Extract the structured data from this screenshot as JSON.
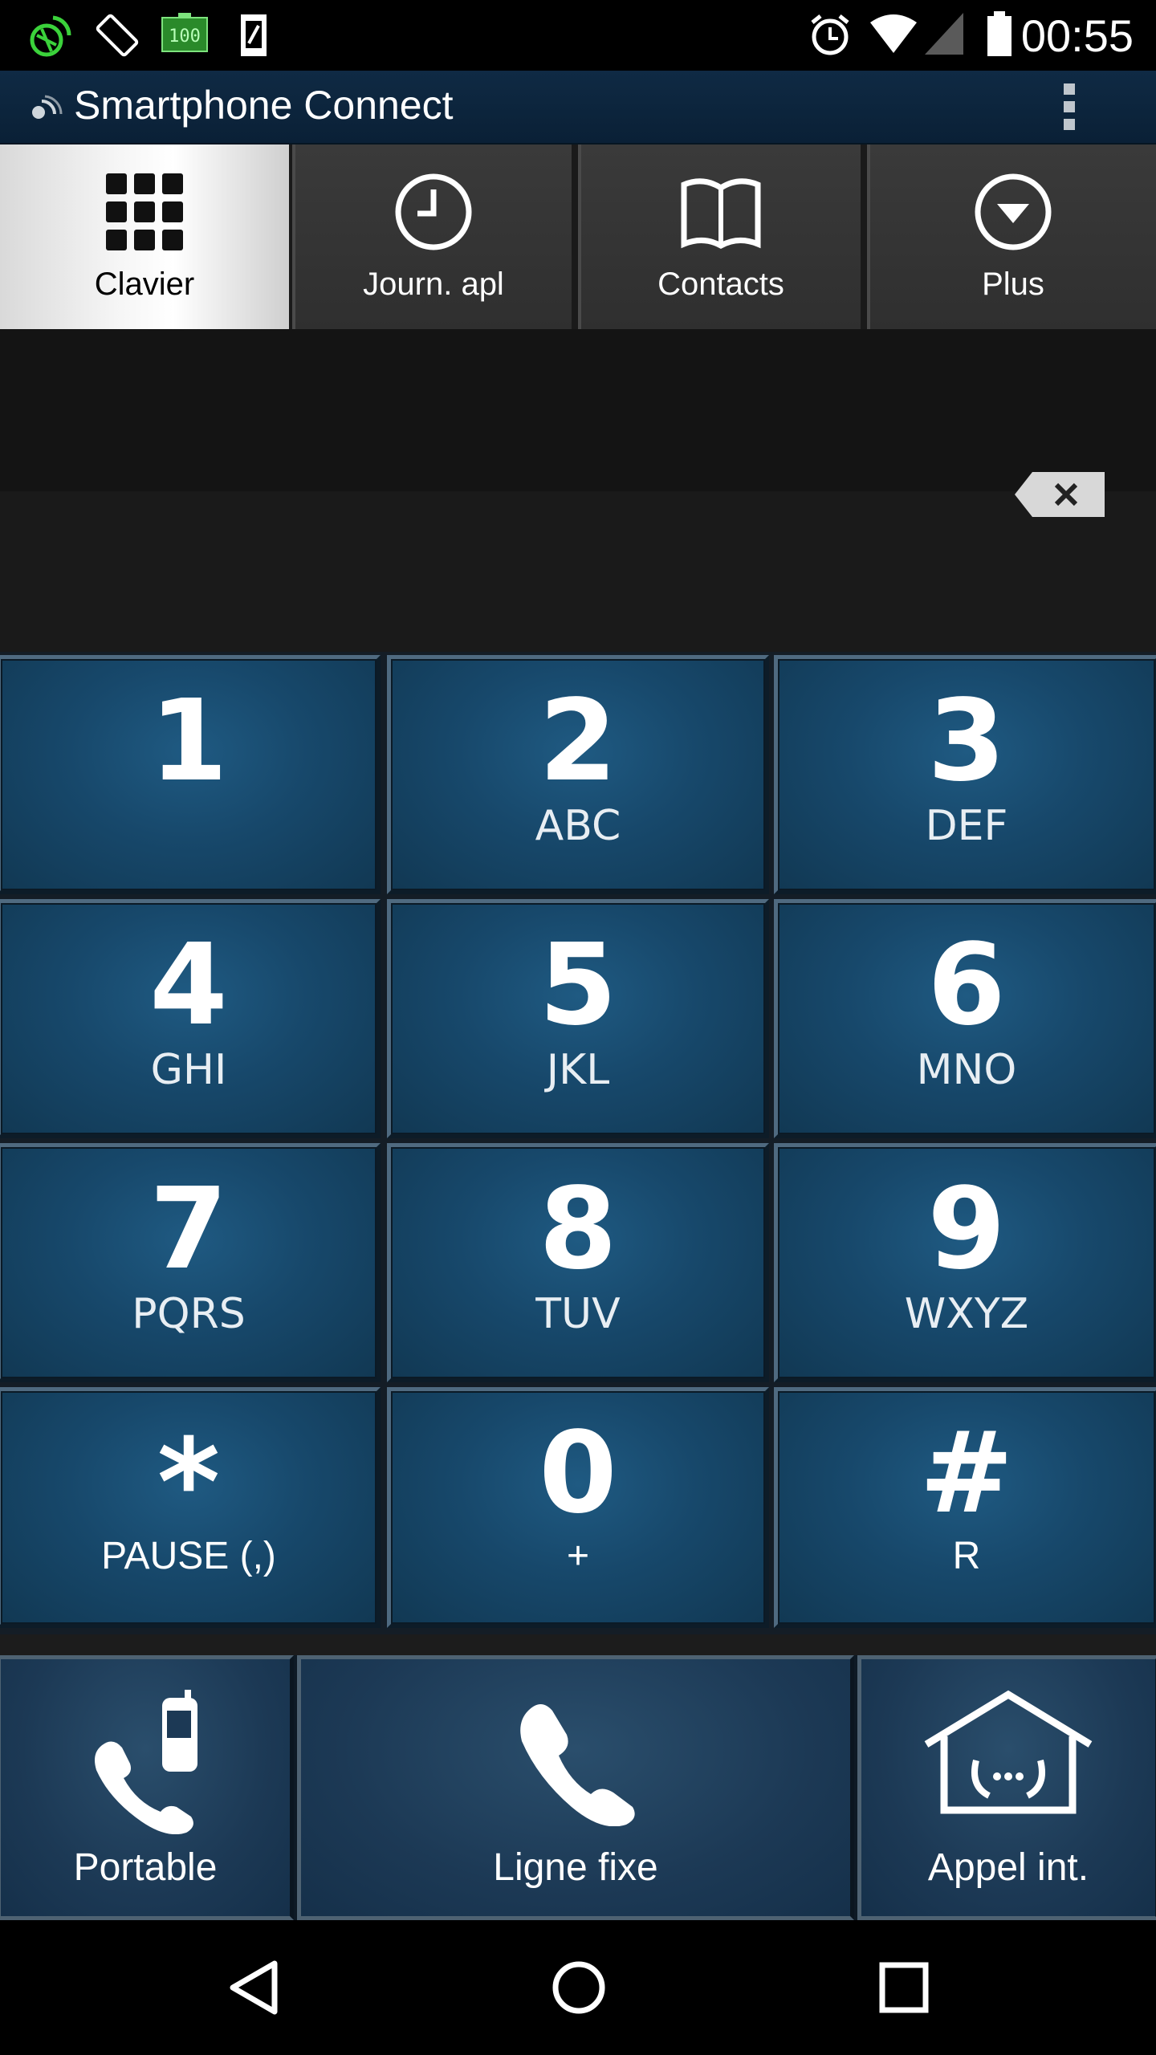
{
  "status_bar": {
    "time": "00:55",
    "icons": [
      "sync-icon",
      "rotate-icon",
      "battery-100-icon",
      "sd-card-icon",
      "alarm-icon",
      "wifi-icon",
      "signal-icon",
      "battery-icon"
    ]
  },
  "app_bar": {
    "title": "Smartphone Connect",
    "overflow_icon": "more-vert-icon"
  },
  "tabs": [
    {
      "label": "Clavier",
      "icon": "keypad-grid-icon",
      "active": true
    },
    {
      "label": "Journ. apl",
      "icon": "clock-icon",
      "active": false
    },
    {
      "label": "Contacts",
      "icon": "book-icon",
      "active": false
    },
    {
      "label": "Plus",
      "icon": "chevron-circle-down-icon",
      "active": false
    }
  ],
  "display": {
    "number": "",
    "backspace_icon": "backspace-icon"
  },
  "keys": [
    {
      "digit": "1",
      "letters": ""
    },
    {
      "digit": "2",
      "letters": "ABC"
    },
    {
      "digit": "3",
      "letters": "DEF"
    },
    {
      "digit": "4",
      "letters": "GHI"
    },
    {
      "digit": "5",
      "letters": "JKL"
    },
    {
      "digit": "6",
      "letters": "MNO"
    },
    {
      "digit": "7",
      "letters": "PQRS"
    },
    {
      "digit": "8",
      "letters": "TUV"
    },
    {
      "digit": "9",
      "letters": "WXYZ"
    },
    {
      "digit": "*",
      "letters": "PAUSE (,)"
    },
    {
      "digit": "0",
      "letters": "+"
    },
    {
      "digit": "#",
      "letters": "R"
    }
  ],
  "call_buttons": [
    {
      "label": "Portable",
      "icon": "mobile-call-icon"
    },
    {
      "label": "Ligne fixe",
      "icon": "phone-icon"
    },
    {
      "label": "Appel int.",
      "icon": "home-call-icon"
    }
  ],
  "nav_bar": {
    "back_icon": "back-icon",
    "home_icon": "home-icon",
    "recents_icon": "recents-icon"
  },
  "colors": {
    "key_blue": "#17486b",
    "app_bar": "#0f2a44",
    "tab_active": "#ffffff"
  }
}
